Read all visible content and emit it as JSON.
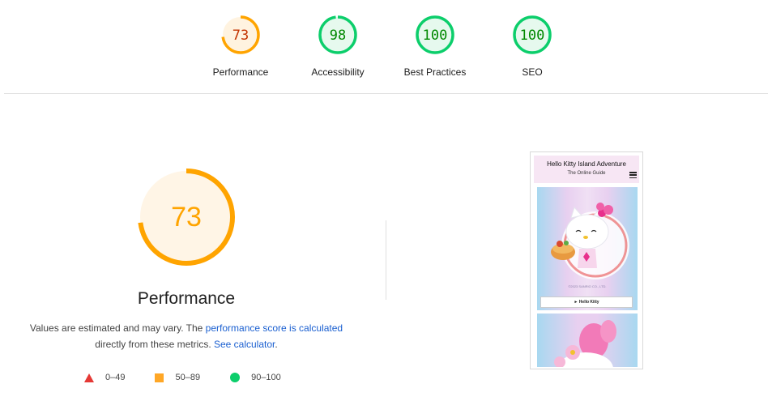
{
  "categories": [
    {
      "label": "Performance",
      "score": "73",
      "fraction": 0.73,
      "color": "#ffa400",
      "text_color": "#c33300",
      "bg": "#fff3e0"
    },
    {
      "label": "Accessibility",
      "score": "98",
      "fraction": 0.98,
      "color": "#0cce6b",
      "text_color": "#008800",
      "bg": "#e6f9ee"
    },
    {
      "label": "Best Practices",
      "score": "100",
      "fraction": 1.0,
      "color": "#0cce6b",
      "text_color": "#008800",
      "bg": "#e6f9ee"
    },
    {
      "label": "SEO",
      "score": "100",
      "fraction": 1.0,
      "color": "#0cce6b",
      "text_color": "#008800",
      "bg": "#e6f9ee"
    }
  ],
  "main": {
    "score": "73",
    "fraction": 0.73,
    "color": "#ffa400",
    "title": "Performance",
    "desc_before": "Values are estimated and may vary. The ",
    "desc_link1": "performance score is calculated",
    "desc_middle": " directly from these metrics. ",
    "desc_link2": "See calculator",
    "desc_after": "."
  },
  "legend": [
    {
      "range": "0–49",
      "shape": "triangle",
      "color": "#e53935"
    },
    {
      "range": "50–89",
      "shape": "square",
      "color": "#ffa726"
    },
    {
      "range": "90–100",
      "shape": "circle",
      "color": "#0cce6b"
    }
  ],
  "thumbnail": {
    "title": "Hello Kitty Island Adventure",
    "subtitle": "The Online Guide",
    "menu_icon": "hamburger-menu-icon",
    "copyright": "©2023 SANRIO CO., LTD.",
    "button_label": "► Hello Kitty"
  }
}
